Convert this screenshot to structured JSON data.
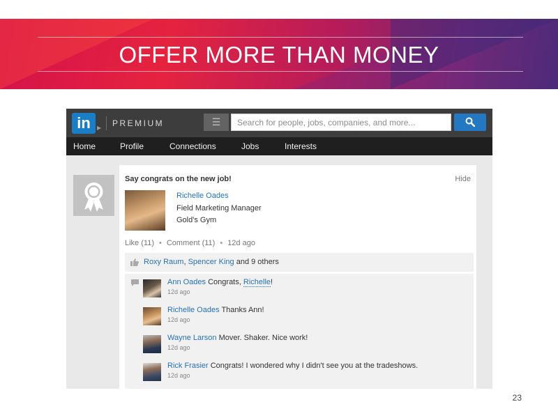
{
  "slide": {
    "title": "OFFER MORE THAN MONEY",
    "page_number": "23"
  },
  "header": {
    "logo_text": "in",
    "product_label": "PREMIUM",
    "menu_icon": "menu-icon",
    "search_placeholder": "Search for people, jobs, companies, and more...",
    "search_icon": "search-icon",
    "brand_color": "#2478c1"
  },
  "nav": {
    "items": [
      "Home",
      "Profile",
      "Connections",
      "Jobs",
      "Interests"
    ]
  },
  "card": {
    "title": "Say congrats on the new job!",
    "hide_label": "Hide",
    "person": {
      "name": "Richelle Oades",
      "job_title": "Field Marketing Manager",
      "company": "Gold's Gym"
    },
    "actions": {
      "like": "Like (11)",
      "comment": "Comment (11)",
      "time": "12d ago"
    },
    "likes": {
      "names": [
        "Roxy Raum",
        "Spencer King"
      ],
      "separator": ",",
      "suffix": "and 9 others"
    },
    "comments": [
      {
        "author": "Ann Oades",
        "text_before": "Congrats,",
        "mention": "Richelle",
        "text_after": "!",
        "time": "12d ago"
      },
      {
        "author": "Richelle Oades",
        "text_before": "Thanks Ann!",
        "mention": "",
        "text_after": "",
        "time": "12d ago"
      },
      {
        "author": "Wayne Larson",
        "text_before": "Mover. Shaker. Nice work!",
        "mention": "",
        "text_after": "",
        "time": "12d ago"
      },
      {
        "author": "Rick Frasier",
        "text_before": "Congrats! I wondered why I didn't see you at the tradeshows.",
        "mention": "",
        "text_after": "",
        "time": "12d ago"
      }
    ]
  }
}
